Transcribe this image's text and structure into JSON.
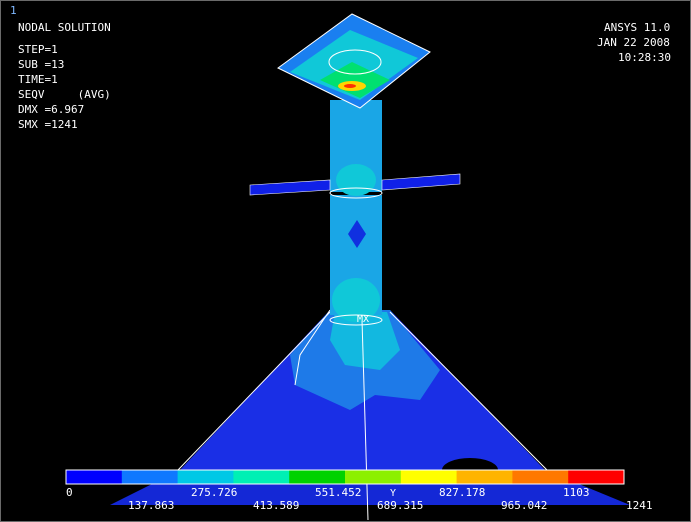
{
  "window_number": "1",
  "header": {
    "title": "NODAL SOLUTION",
    "lines": [
      "STEP=1",
      "SUB =13",
      "TIME=1",
      "SEQV     (AVG)",
      "DMX =6.967",
      "SMX =1241"
    ]
  },
  "version": {
    "product": "ANSYS 11.0",
    "date": "JAN 22 2008",
    "time": "10:28:30"
  },
  "plot_markers": {
    "max_label": "MX",
    "axis_label": "Y"
  },
  "legend": {
    "colors": [
      "#0000ff",
      "#0f78ff",
      "#00c8e6",
      "#00f0b4",
      "#00d200",
      "#8cf000",
      "#ffff00",
      "#ffb400",
      "#ff7800",
      "#ff0000"
    ],
    "top_labels": [
      "0",
      "275.726",
      "551.452",
      "827.178",
      "1103"
    ],
    "bottom_labels": [
      "137.863",
      "413.589",
      "689.315",
      "965.042",
      "1241"
    ]
  }
}
